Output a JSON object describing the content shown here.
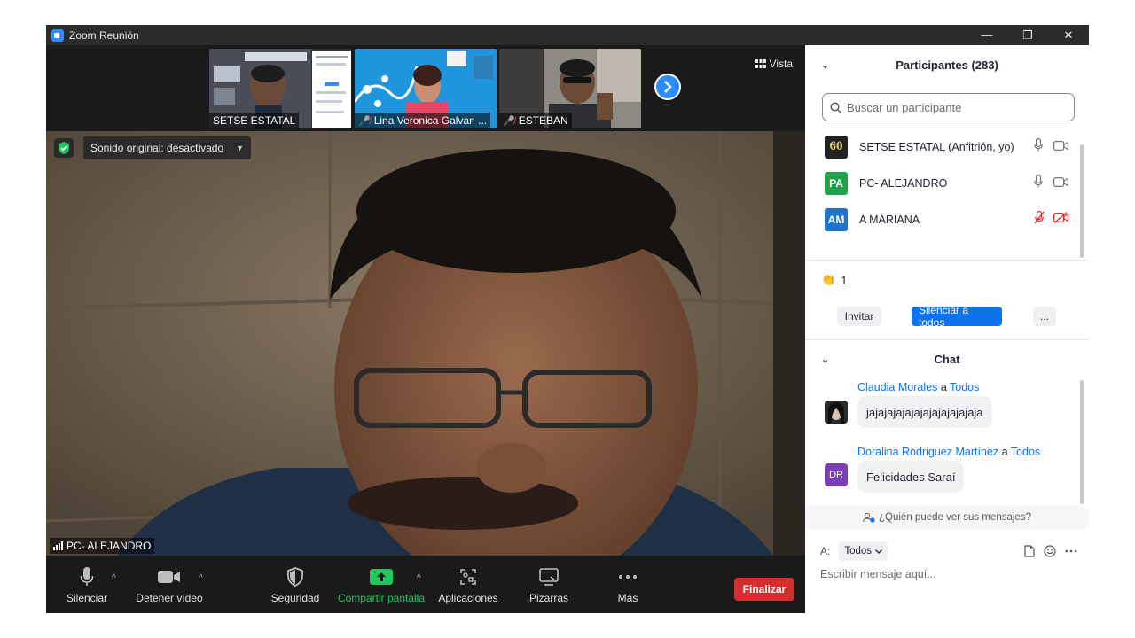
{
  "window": {
    "title": "Zoom Reunión",
    "controls": [
      "—",
      "❐",
      "✕"
    ]
  },
  "strip": {
    "thumbnails": [
      {
        "name": "SETSE ESTATAL",
        "muted": false
      },
      {
        "name": "Lina Veronica Galvan ...",
        "muted": true
      },
      {
        "name": "ESTEBAN",
        "muted": true
      }
    ],
    "next_icon": "chevron-right-icon",
    "view_label": "Vista"
  },
  "main_video": {
    "sound_label": "Sonido original: desactivado",
    "speaker_name": "PC- ALEJANDRO"
  },
  "toolbar": {
    "mute_label": "Silenciar",
    "video_label": "Detener vídeo",
    "security_label": "Seguridad",
    "share_label": "Compartir pantalla",
    "apps_label": "Aplicaciones",
    "whiteboard_label": "Pizarras",
    "more_label": "Más",
    "end_label": "Finalizar"
  },
  "participants": {
    "title": "Participantes (283)",
    "search_placeholder": "Buscar un participante",
    "list": [
      {
        "name": "SETSE ESTATAL (Anfitrión, yo)",
        "initials": "60",
        "avatar_color": "#222222",
        "mic_muted": false,
        "cam_off": false
      },
      {
        "name": "PC- ALEJANDRO",
        "initials": "PA",
        "avatar_color": "#1fa24a",
        "mic_muted": false,
        "cam_off": false
      },
      {
        "name": "A MARIANA",
        "initials": "AM",
        "avatar_color": "#1e72c8",
        "mic_muted": true,
        "cam_off": true
      }
    ],
    "reaction_count": "1",
    "invite_label": "Invitar",
    "mute_all_label": "Silenciar a todos",
    "more_label": "..."
  },
  "chat": {
    "title": "Chat",
    "messages": [
      {
        "sender": "Claudia Morales",
        "to_word": "a",
        "recipient": "Todos",
        "text": "jajajajajajajajajajajajaja",
        "initials": "",
        "avatar_color": "#333333"
      },
      {
        "sender": "Doralina Rodriguez Martínez",
        "to_word": "a",
        "recipient": "Todos",
        "text": "Felicidades Saraí",
        "initials": "DR",
        "avatar_color": "#7b3fb5"
      }
    ],
    "who_sees_label": "¿Quién puede ver sus mensajes?",
    "to_label": "A:",
    "to_value": "Todos",
    "input_placeholder": "Escribir mensaje aquí..."
  },
  "colors": {
    "brand": "#2d8cff",
    "end_red": "#d32f2f",
    "share_green": "#22c55e",
    "primary_button": "#0e72ed"
  }
}
